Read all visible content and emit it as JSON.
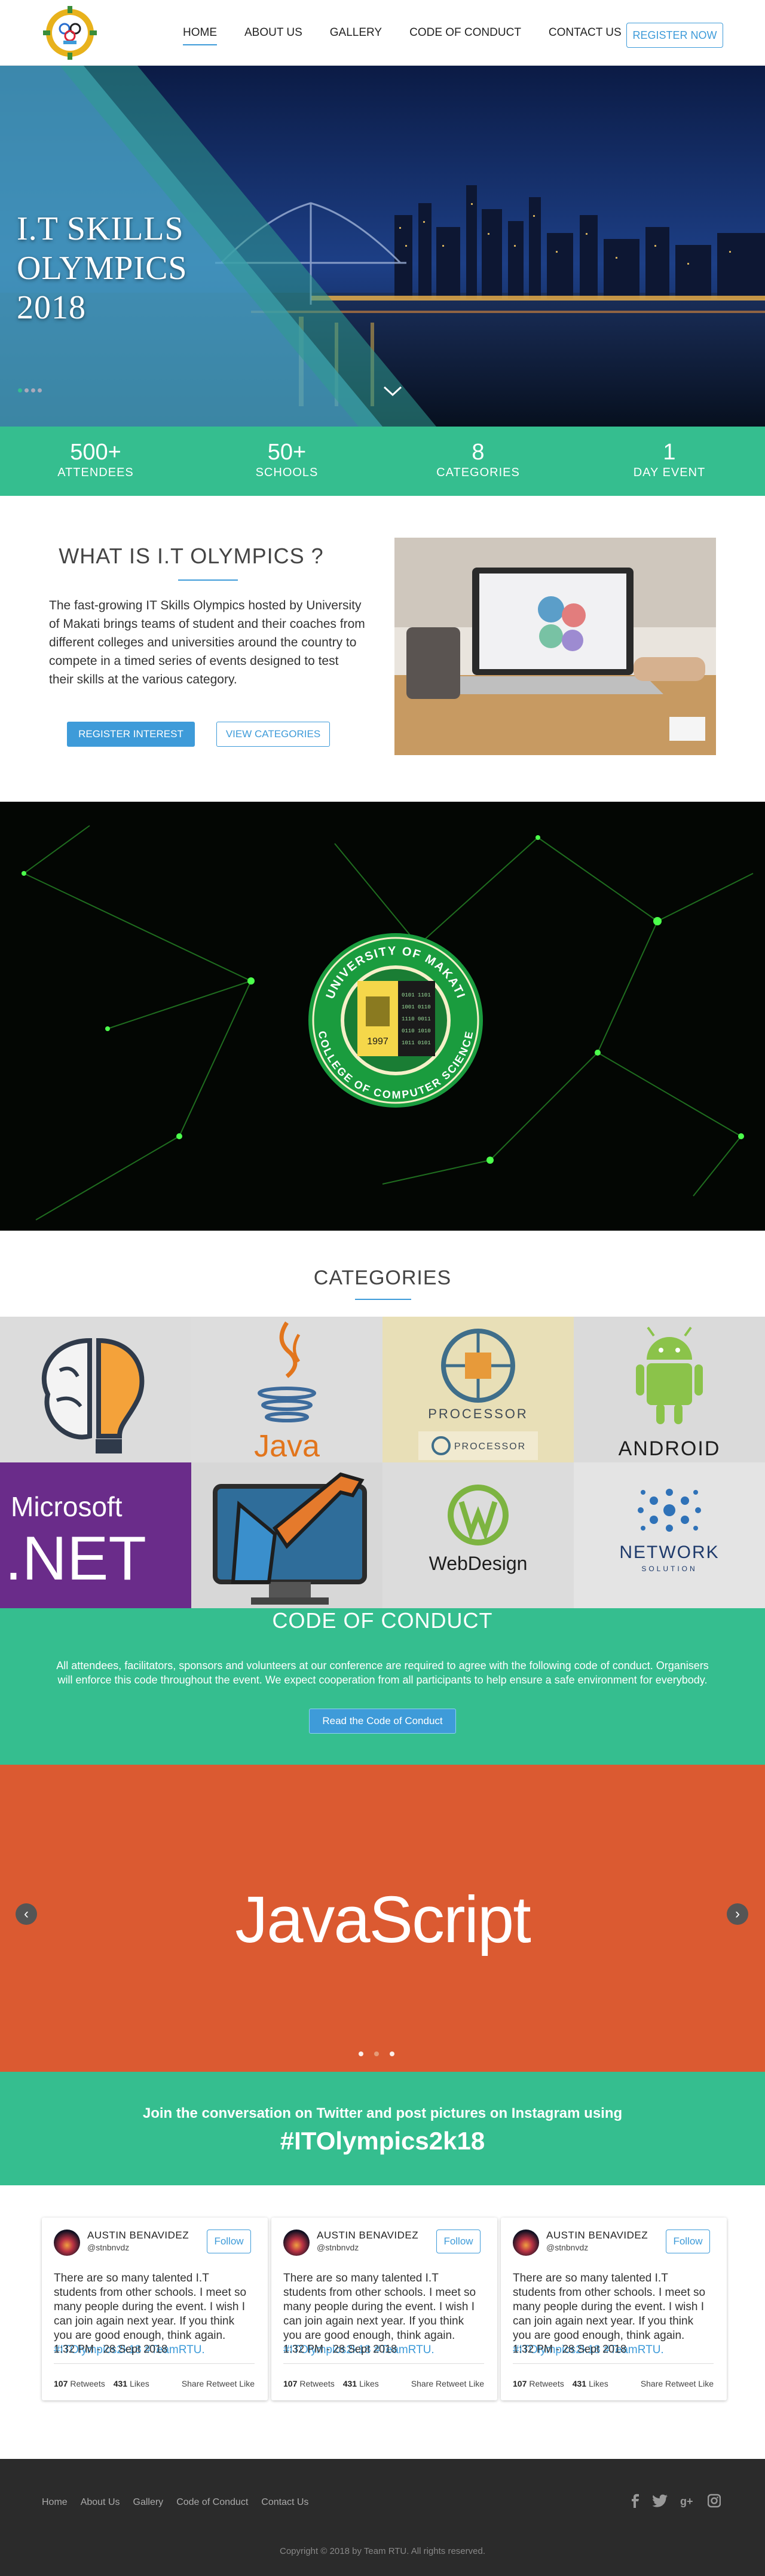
{
  "nav": {
    "logo_alt": "I.T Skills Olympics logo",
    "items": [
      {
        "label": "HOME",
        "active": true
      },
      {
        "label": "ABOUT US",
        "active": false
      },
      {
        "label": "GALLERY",
        "active": false
      },
      {
        "label": "CODE OF CONDUCT",
        "active": false
      },
      {
        "label": "CONTACT US",
        "active": false
      }
    ],
    "register": "REGISTER NOW"
  },
  "hero": {
    "title_line1": "I.T SKILLS",
    "title_line2": "OLYMPICS",
    "title_line3": "2018",
    "scroll_icon": "chevron-down-icon"
  },
  "stats": [
    {
      "number": "500+",
      "label": "ATTENDEES"
    },
    {
      "number": "50+",
      "label": "SCHOOLS"
    },
    {
      "number": "8",
      "label": "CATEGORIES"
    },
    {
      "number": "1",
      "label": "DAY EVENT"
    }
  ],
  "about": {
    "title": "WHAT IS I.T OLYMPICS ?",
    "text": "The fast-growing IT Skills Olympics hosted by University of Makati brings teams of student and their coaches from different colleges and universities around the country to compete in a timed series of events designed to test their skills at the various category.",
    "btn_register": "REGISTER INTEREST",
    "btn_categories": "VIEW CATEGORIES"
  },
  "seal": {
    "top_text": "UNIVERSITY OF MAKATI",
    "bottom_text": "COLLEGE OF COMPUTER SCIENCE",
    "year": "1997"
  },
  "categories": {
    "title": "CATEGORIES",
    "java": "Java",
    "processor": "PROCESSOR",
    "processor_small": "PROCESSOR",
    "android": "ANDROID",
    "microsoft": "Microsoft",
    "dotnet": ".NET",
    "webdesign": "WebDesign",
    "network": "NETWORK",
    "network_sub": "SOLUTION"
  },
  "coc": {
    "title": "CODE OF CONDUCT",
    "text": "All attendees, facilitators, sponsors and volunteers at our conference are required to agree with the following code of conduct. Organisers will enforce this code throughout the event. We expect cooperation from all participants to help ensure a safe environment for everybody.",
    "button": "Read the Code of Conduct"
  },
  "carousel": {
    "slide_text": "JavaScript",
    "prev": "‹",
    "next": "›",
    "active_index": 1,
    "slide_count": 3
  },
  "twitter": {
    "line": "Join the conversation on Twitter and post pictures on Instagram using",
    "hashtag": "#ITOlympics2k18"
  },
  "tweets": [
    {
      "name": "AUSTIN BENAVIDEZ",
      "handle": "@stnbnvdz",
      "follow": "Follow",
      "text": "There are so many talented I.T students from other schools. I meet so many people during the event. I wish I can join again next year. If you think you are good enough, think again.",
      "tags": "#ITOlympics2k18 #TeamRTU.",
      "time": "1:32 PM - 28 Sept 2018",
      "retweets": "107",
      "retweets_label": "Retweets",
      "likes": "431",
      "likes_label": "Likes",
      "actions": "Share Retweet Like"
    },
    {
      "name": "AUSTIN BENAVIDEZ",
      "handle": "@stnbnvdz",
      "follow": "Follow",
      "text": "There are so many talented I.T students from other schools. I meet so many people during the event. I wish I can join again next year. If you think you are good enough, think again.",
      "tags": "#ITOlympics2k18 #TeamRTU.",
      "time": "1:32 PM - 28 Sept 2018",
      "retweets": "107",
      "retweets_label": "Retweets",
      "likes": "431",
      "likes_label": "Likes",
      "actions": "Share Retweet Like"
    },
    {
      "name": "AUSTIN BENAVIDEZ",
      "handle": "@stnbnvdz",
      "follow": "Follow",
      "text": "There are so many talented I.T students from other schools. I meet so many people during the event. I wish I can join again next year. If you think you are good enough, think again.",
      "tags": "#ITOlympics2k18 #TeamRTU.",
      "time": "1:32 PM - 28 Sept 2018",
      "retweets": "107",
      "retweets_label": "Retweets",
      "likes": "431",
      "likes_label": "Likes",
      "actions": "Share Retweet Like"
    }
  ],
  "footer": {
    "links": [
      "Home",
      "About Us",
      "Gallery",
      "Code of Conduct",
      "Contact Us"
    ],
    "social_icons": [
      "facebook-icon",
      "twitter-icon",
      "google-plus-icon",
      "instagram-icon"
    ],
    "copyright": "Copyright © 2018 by Team RTU. All rights reserved."
  },
  "colors": {
    "accent_green": "#35be8f",
    "accent_blue": "#3e9bd9",
    "javascript_orange": "#db5a31",
    "footer_dark": "#2b2b2b"
  }
}
